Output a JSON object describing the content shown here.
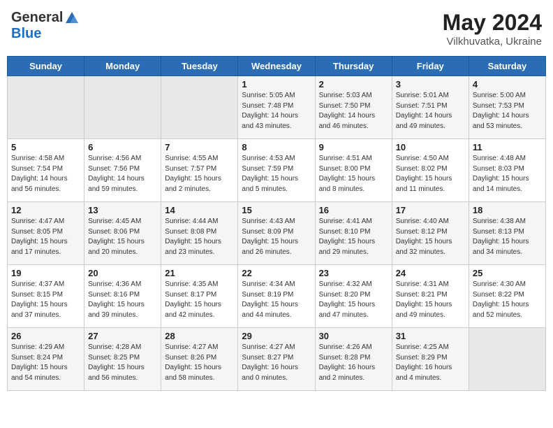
{
  "header": {
    "logo_general": "General",
    "logo_blue": "Blue",
    "title": "May 2024",
    "subtitle": "Vilkhuvatka, Ukraine"
  },
  "weekdays": [
    "Sunday",
    "Monday",
    "Tuesday",
    "Wednesday",
    "Thursday",
    "Friday",
    "Saturday"
  ],
  "weeks": [
    [
      {
        "day": "",
        "empty": true
      },
      {
        "day": "",
        "empty": true
      },
      {
        "day": "",
        "empty": true
      },
      {
        "day": "1",
        "sunrise": "5:05 AM",
        "sunset": "7:48 PM",
        "daylight": "14 hours and 43 minutes."
      },
      {
        "day": "2",
        "sunrise": "5:03 AM",
        "sunset": "7:50 PM",
        "daylight": "14 hours and 46 minutes."
      },
      {
        "day": "3",
        "sunrise": "5:01 AM",
        "sunset": "7:51 PM",
        "daylight": "14 hours and 49 minutes."
      },
      {
        "day": "4",
        "sunrise": "5:00 AM",
        "sunset": "7:53 PM",
        "daylight": "14 hours and 53 minutes."
      }
    ],
    [
      {
        "day": "5",
        "sunrise": "4:58 AM",
        "sunset": "7:54 PM",
        "daylight": "14 hours and 56 minutes."
      },
      {
        "day": "6",
        "sunrise": "4:56 AM",
        "sunset": "7:56 PM",
        "daylight": "14 hours and 59 minutes."
      },
      {
        "day": "7",
        "sunrise": "4:55 AM",
        "sunset": "7:57 PM",
        "daylight": "15 hours and 2 minutes."
      },
      {
        "day": "8",
        "sunrise": "4:53 AM",
        "sunset": "7:59 PM",
        "daylight": "15 hours and 5 minutes."
      },
      {
        "day": "9",
        "sunrise": "4:51 AM",
        "sunset": "8:00 PM",
        "daylight": "15 hours and 8 minutes."
      },
      {
        "day": "10",
        "sunrise": "4:50 AM",
        "sunset": "8:02 PM",
        "daylight": "15 hours and 11 minutes."
      },
      {
        "day": "11",
        "sunrise": "4:48 AM",
        "sunset": "8:03 PM",
        "daylight": "15 hours and 14 minutes."
      }
    ],
    [
      {
        "day": "12",
        "sunrise": "4:47 AM",
        "sunset": "8:05 PM",
        "daylight": "15 hours and 17 minutes."
      },
      {
        "day": "13",
        "sunrise": "4:45 AM",
        "sunset": "8:06 PM",
        "daylight": "15 hours and 20 minutes."
      },
      {
        "day": "14",
        "sunrise": "4:44 AM",
        "sunset": "8:08 PM",
        "daylight": "15 hours and 23 minutes."
      },
      {
        "day": "15",
        "sunrise": "4:43 AM",
        "sunset": "8:09 PM",
        "daylight": "15 hours and 26 minutes."
      },
      {
        "day": "16",
        "sunrise": "4:41 AM",
        "sunset": "8:10 PM",
        "daylight": "15 hours and 29 minutes."
      },
      {
        "day": "17",
        "sunrise": "4:40 AM",
        "sunset": "8:12 PM",
        "daylight": "15 hours and 32 minutes."
      },
      {
        "day": "18",
        "sunrise": "4:38 AM",
        "sunset": "8:13 PM",
        "daylight": "15 hours and 34 minutes."
      }
    ],
    [
      {
        "day": "19",
        "sunrise": "4:37 AM",
        "sunset": "8:15 PM",
        "daylight": "15 hours and 37 minutes."
      },
      {
        "day": "20",
        "sunrise": "4:36 AM",
        "sunset": "8:16 PM",
        "daylight": "15 hours and 39 minutes."
      },
      {
        "day": "21",
        "sunrise": "4:35 AM",
        "sunset": "8:17 PM",
        "daylight": "15 hours and 42 minutes."
      },
      {
        "day": "22",
        "sunrise": "4:34 AM",
        "sunset": "8:19 PM",
        "daylight": "15 hours and 44 minutes."
      },
      {
        "day": "23",
        "sunrise": "4:32 AM",
        "sunset": "8:20 PM",
        "daylight": "15 hours and 47 minutes."
      },
      {
        "day": "24",
        "sunrise": "4:31 AM",
        "sunset": "8:21 PM",
        "daylight": "15 hours and 49 minutes."
      },
      {
        "day": "25",
        "sunrise": "4:30 AM",
        "sunset": "8:22 PM",
        "daylight": "15 hours and 52 minutes."
      }
    ],
    [
      {
        "day": "26",
        "sunrise": "4:29 AM",
        "sunset": "8:24 PM",
        "daylight": "15 hours and 54 minutes."
      },
      {
        "day": "27",
        "sunrise": "4:28 AM",
        "sunset": "8:25 PM",
        "daylight": "15 hours and 56 minutes."
      },
      {
        "day": "28",
        "sunrise": "4:27 AM",
        "sunset": "8:26 PM",
        "daylight": "15 hours and 58 minutes."
      },
      {
        "day": "29",
        "sunrise": "4:27 AM",
        "sunset": "8:27 PM",
        "daylight": "16 hours and 0 minutes."
      },
      {
        "day": "30",
        "sunrise": "4:26 AM",
        "sunset": "8:28 PM",
        "daylight": "16 hours and 2 minutes."
      },
      {
        "day": "31",
        "sunrise": "4:25 AM",
        "sunset": "8:29 PM",
        "daylight": "16 hours and 4 minutes."
      },
      {
        "day": "",
        "empty": true
      }
    ]
  ]
}
